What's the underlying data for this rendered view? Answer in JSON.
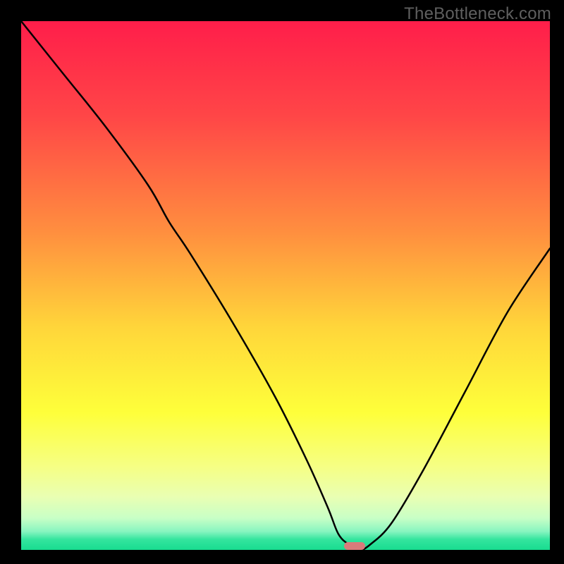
{
  "watermark": {
    "text": "TheBottleneck.com"
  },
  "chart_data": {
    "type": "line",
    "title": "",
    "xlabel": "",
    "ylabel": "",
    "xlim": [
      0,
      100
    ],
    "ylim": [
      0,
      100
    ],
    "series": [
      {
        "name": "bottleneck-curve",
        "x": [
          0,
          8,
          16,
          24,
          28,
          32,
          40,
          48,
          54,
          58,
          60,
          62,
          64,
          66,
          70,
          76,
          84,
          92,
          100
        ],
        "values": [
          100,
          90,
          80,
          69,
          62,
          56,
          43,
          29,
          17,
          8,
          3,
          1,
          0,
          1,
          5,
          15,
          30,
          45,
          57
        ]
      }
    ],
    "marker": {
      "x": 63,
      "y": 0.7,
      "color": "#d97b7b",
      "width_pct": 4.0,
      "height_pct": 1.5
    },
    "gradient_stops": [
      {
        "pct": 0,
        "color": "#ff1e4a"
      },
      {
        "pct": 18,
        "color": "#ff4647"
      },
      {
        "pct": 40,
        "color": "#ff8f3f"
      },
      {
        "pct": 58,
        "color": "#ffd63a"
      },
      {
        "pct": 74,
        "color": "#feff3a"
      },
      {
        "pct": 84,
        "color": "#f6ff82"
      },
      {
        "pct": 90,
        "color": "#e9ffb3"
      },
      {
        "pct": 94,
        "color": "#c8ffc6"
      },
      {
        "pct": 96.5,
        "color": "#88f5c0"
      },
      {
        "pct": 98,
        "color": "#35e59e"
      },
      {
        "pct": 100,
        "color": "#18dc90"
      }
    ]
  }
}
